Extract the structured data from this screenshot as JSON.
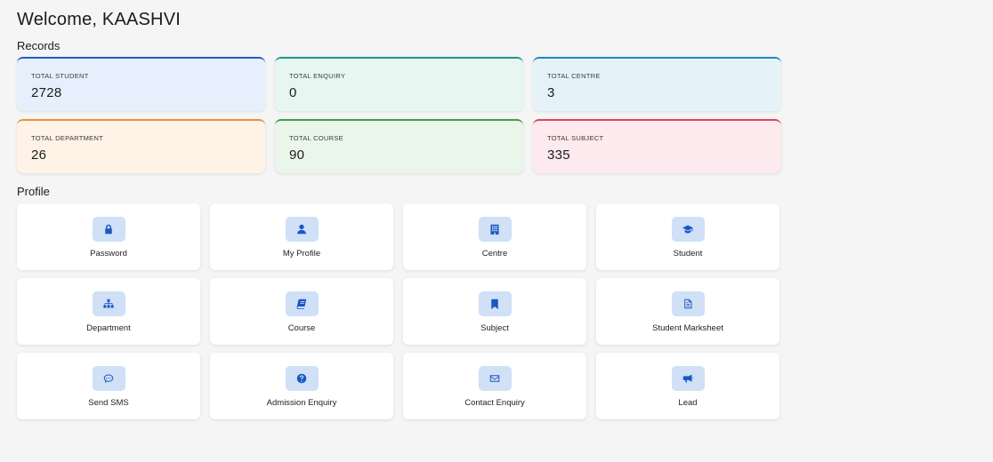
{
  "header": {
    "welcome": "Welcome, KAASHVI"
  },
  "records": {
    "title": "Records",
    "cards": [
      {
        "label": "TOTAL STUDENT",
        "value": "2728",
        "bg": "#e6f0fd",
        "accent": "#1e5fc9"
      },
      {
        "label": "TOTAL ENQUIRY",
        "value": "0",
        "bg": "#e7f6f1",
        "accent": "#1a9a8a"
      },
      {
        "label": "TOTAL CENTRE",
        "value": "3",
        "bg": "#e5f3f9",
        "accent": "#1a8cb5"
      },
      {
        "label": "TOTAL DEPARTMENT",
        "value": "26",
        "bg": "#fef3e6",
        "accent": "#e8943a"
      },
      {
        "label": "TOTAL COURSE",
        "value": "90",
        "bg": "#ebf6ea",
        "accent": "#3f9e4a"
      },
      {
        "label": "TOTAL SUBJECT",
        "value": "335",
        "bg": "#fdeaee",
        "accent": "#d24a63"
      }
    ]
  },
  "profile": {
    "title": "Profile",
    "tiles": [
      {
        "label": "Password",
        "icon": "lock-icon"
      },
      {
        "label": "My Profile",
        "icon": "user-icon"
      },
      {
        "label": "Centre",
        "icon": "building-icon"
      },
      {
        "label": "Student",
        "icon": "graduation-cap-icon"
      },
      {
        "label": "Department",
        "icon": "sitemap-icon"
      },
      {
        "label": "Course",
        "icon": "book-icon"
      },
      {
        "label": "Subject",
        "icon": "bookmark-icon"
      },
      {
        "label": "Student Marksheet",
        "icon": "document-icon"
      },
      {
        "label": "Send SMS",
        "icon": "chat-icon"
      },
      {
        "label": "Admission Enquiry",
        "icon": "question-circle-icon"
      },
      {
        "label": "Contact Enquiry",
        "icon": "envelope-icon"
      },
      {
        "label": "Lead",
        "icon": "megaphone-icon"
      }
    ]
  }
}
